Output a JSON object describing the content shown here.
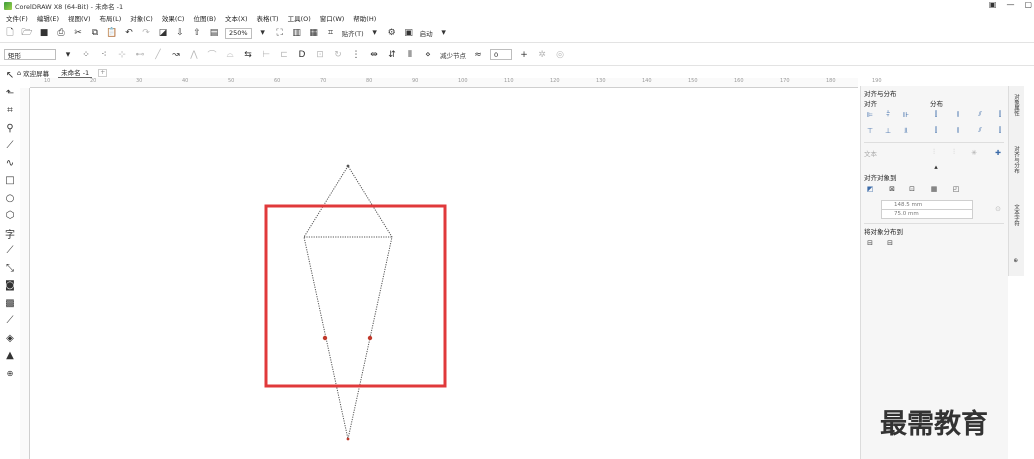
{
  "window": {
    "title": "CorelDRAW X8 (64-Bit) - 未命名 -1",
    "controls": [
      "▣",
      "—",
      "▢"
    ]
  },
  "menu": {
    "items": [
      "文件(F)",
      "编辑(E)",
      "视图(V)",
      "布局(L)",
      "对象(C)",
      "效果(C)",
      "位图(B)",
      "文本(X)",
      "表格(T)",
      "工具(O)",
      "窗口(W)",
      "帮助(H)"
    ]
  },
  "toolbar": {
    "zoom_value": "250%",
    "snap_label": "贴齐(T)",
    "launch_label": "启动"
  },
  "propertybar": {
    "object_type": "矩形",
    "reduce_nodes_label": "减少节点",
    "smooth_value": "0"
  },
  "tabs": {
    "welcome": "欢迎屏幕",
    "document": "未命名 -1"
  },
  "ruler": {
    "h_labels": [
      "10",
      "20",
      "30",
      "40",
      "50",
      "60",
      "70",
      "80",
      "90",
      "100",
      "110",
      "120",
      "130",
      "140",
      "150",
      "160",
      "170",
      "180",
      "190"
    ]
  },
  "docker": {
    "title": "对齐与分布",
    "align_label": "对齐",
    "distribute_label": "分布",
    "text_label": "文本",
    "align_objects_to_label": "对齐对象到",
    "x_value": "148.5 mm",
    "y_value": "75.0 mm",
    "distribute_objects_to_label": "将对象分布到"
  },
  "side_tabs": [
    "对象属性",
    "对齐与分布",
    "文本字符"
  ],
  "watermark": "最需教育",
  "colors": {
    "highlight_box": "#e0393b",
    "node": "#c0392b",
    "path": "#555555"
  }
}
